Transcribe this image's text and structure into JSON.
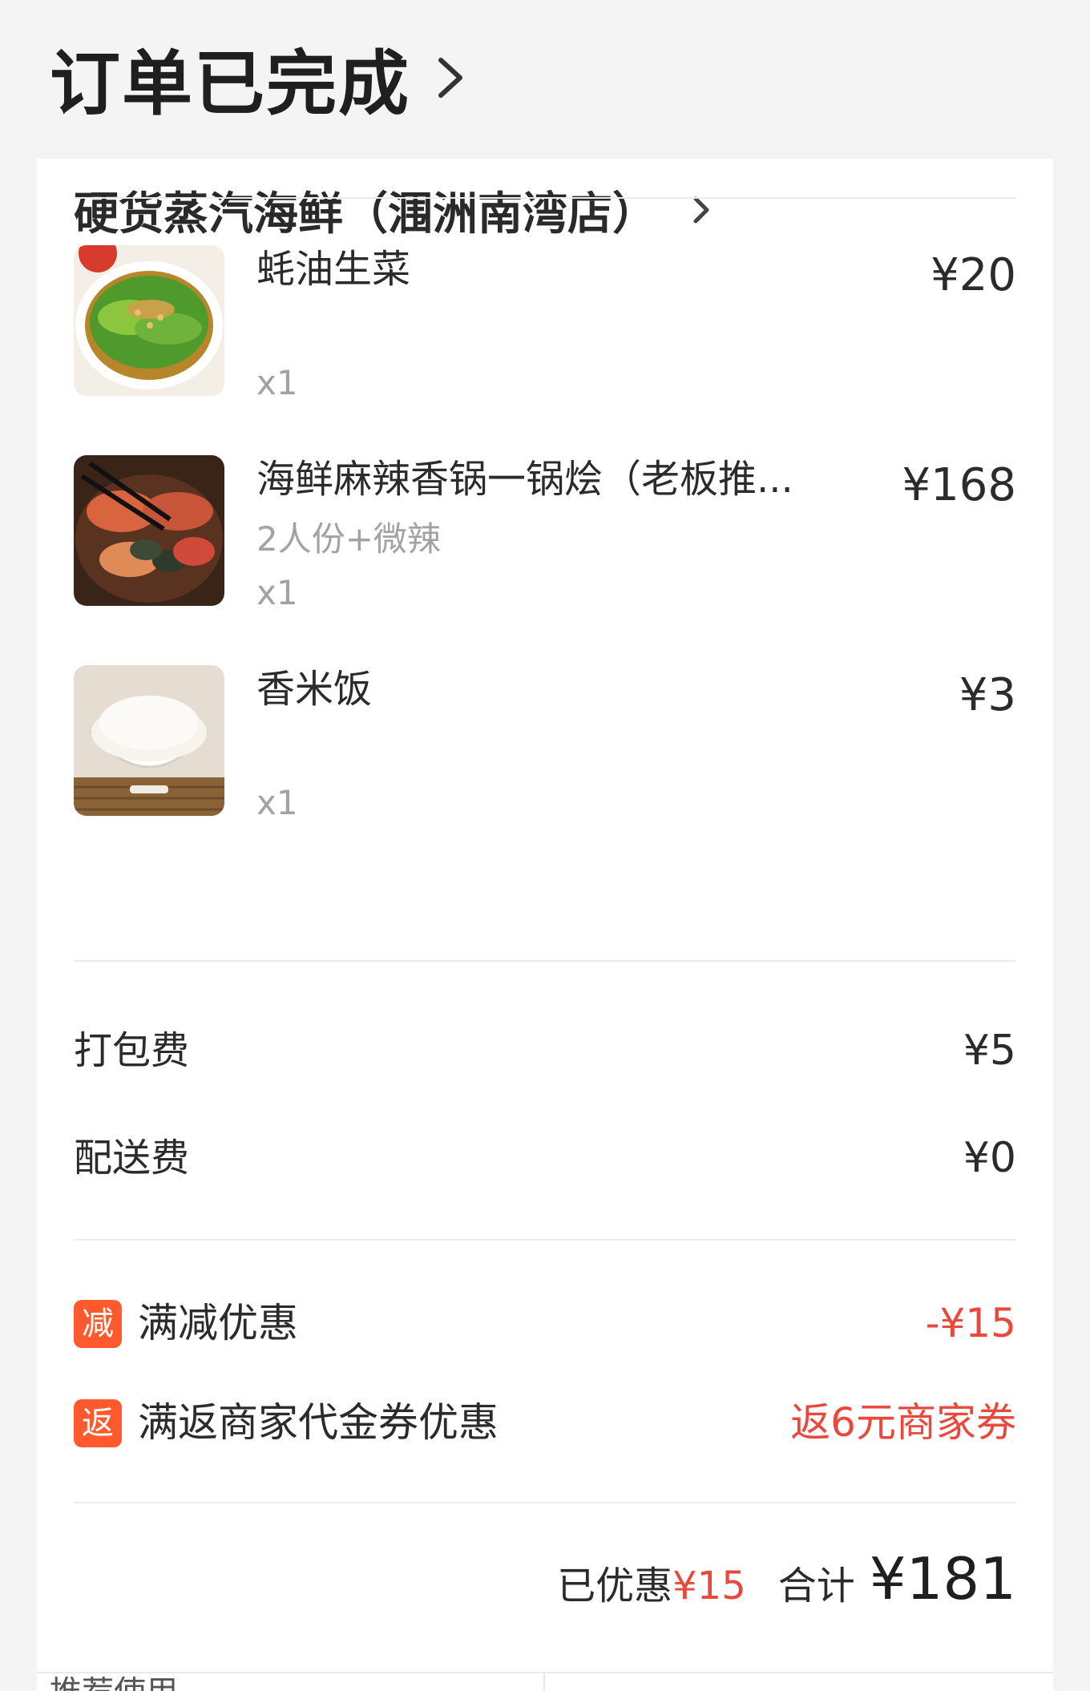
{
  "header": {
    "title": "订单已完成",
    "chevron_icon": "chevron-right-icon"
  },
  "store": {
    "name": "硬货蒸汽海鲜（涠洲南湾店）",
    "chevron_icon": "chevron-right-icon"
  },
  "items": [
    {
      "name": "蚝油生菜",
      "spec": "",
      "qty": "x1",
      "price": "¥20",
      "image": "oyster-sauce-lettuce-image"
    },
    {
      "name": "海鲜麻辣香锅一锅烩（老板推...",
      "spec": "2人份+微辣",
      "qty": "x1",
      "price": "¥168",
      "image": "seafood-spicy-pot-image"
    },
    {
      "name": "香米饭",
      "spec": "",
      "qty": "x1",
      "price": "¥3",
      "image": "fragrant-rice-image"
    }
  ],
  "fees": [
    {
      "label": "打包费",
      "value": "¥5"
    },
    {
      "label": "配送费",
      "value": "¥0"
    }
  ],
  "promotions": [
    {
      "badge": "减",
      "label": "满减优惠",
      "value": "-¥15"
    },
    {
      "badge": "返",
      "label": "满返商家代金券优惠",
      "value": "返6元商家券"
    }
  ],
  "totals": {
    "saved_label": "已优惠",
    "saved_value": "¥15",
    "total_label": "合计",
    "total_value": "¥181"
  },
  "bottom": {
    "peek_text": "推荐使用"
  },
  "colors": {
    "accent_red": "#e9493d",
    "badge_orange": "#ff5a2e",
    "background": "#f4f4f4",
    "card": "#ffffff"
  }
}
